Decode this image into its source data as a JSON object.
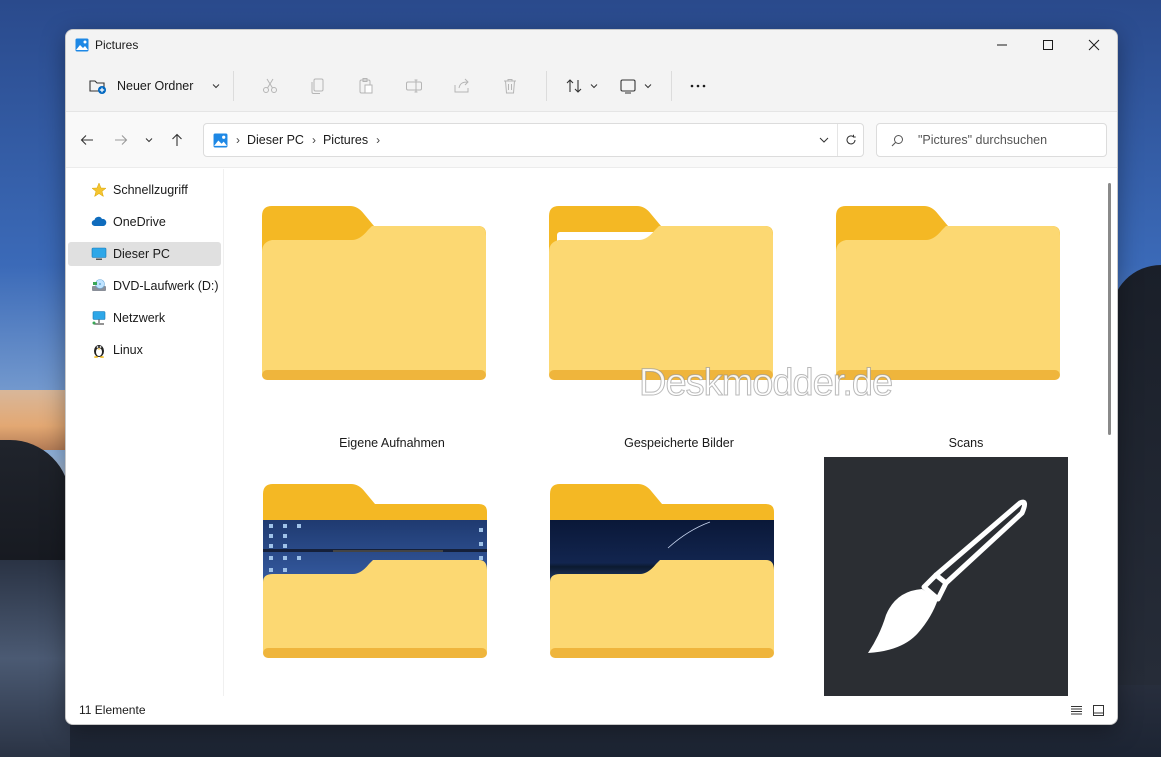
{
  "window": {
    "title": "Pictures"
  },
  "toolbar": {
    "new_folder_label": "Neuer Ordner",
    "icons": [
      "cut-icon",
      "copy-icon",
      "paste-icon",
      "rename-icon",
      "share-icon",
      "delete-icon",
      "sort-icon",
      "view-icon",
      "more-icon"
    ]
  },
  "address": {
    "crumbs": [
      "Dieser PC",
      "Pictures"
    ]
  },
  "search": {
    "placeholder": "\"Pictures\" durchsuchen"
  },
  "sidebar": {
    "items": [
      {
        "label": "Schnellzugriff",
        "icon": "star-icon"
      },
      {
        "label": "OneDrive",
        "icon": "cloud-icon"
      },
      {
        "label": "Dieser PC",
        "icon": "monitor-icon",
        "selected": true
      },
      {
        "label": "DVD-Laufwerk (D:) C",
        "icon": "dvd-drive-icon"
      },
      {
        "label": "Netzwerk",
        "icon": "network-icon"
      },
      {
        "label": "Linux",
        "icon": "penguin-icon"
      }
    ]
  },
  "content": {
    "items": [
      {
        "label": "Eigene Aufnahmen",
        "type": "folder-empty"
      },
      {
        "label": "Gespeicherte Bilder",
        "type": "folder-paper"
      },
      {
        "label": "Scans",
        "type": "folder-empty"
      },
      {
        "label": "",
        "type": "folder-desktop"
      },
      {
        "label": "",
        "type": "folder-wallpaper"
      },
      {
        "label": "",
        "type": "image-paintbrush"
      }
    ],
    "watermark": "Deskmodder.de"
  },
  "status": {
    "count_text": "11 Elemente"
  },
  "colors": {
    "folder_back": "#f4b824",
    "folder_front": "#fcd872",
    "accent": "#0067c0",
    "selected_bg": "#e0e0e0"
  }
}
